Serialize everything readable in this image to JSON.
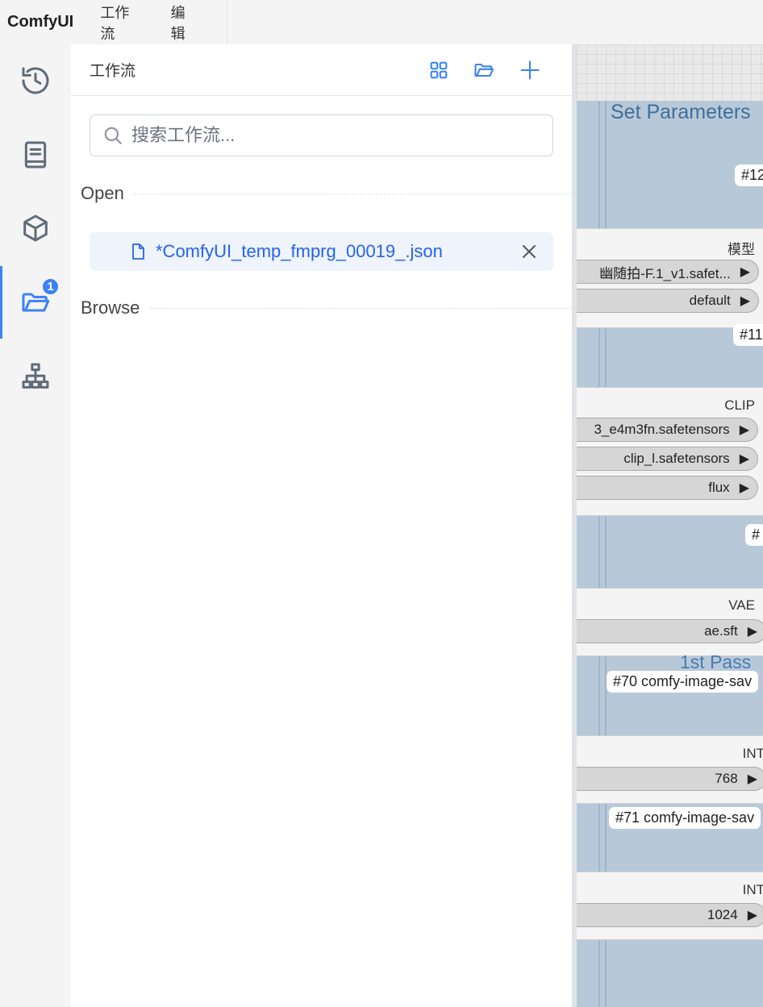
{
  "menubar": {
    "logo": "ComfyUI",
    "items": [
      "工作流",
      "编辑"
    ]
  },
  "rail": {
    "badge": "1"
  },
  "panel": {
    "title": "工作流",
    "search_placeholder": "搜索工作流...",
    "open_label": "Open",
    "browse_label": "Browse",
    "open_file": "*ComfyUI_temp_fmprg_00019_.json"
  },
  "canvas": {
    "group_title": "Set Parameters",
    "tags": [
      "#12",
      "#11",
      "#",
      "#70 comfy-image-sav",
      "#71 comfy-image-sav"
    ],
    "pass_title": "1st Pass",
    "nodes": [
      {
        "header": "模型",
        "widgets": [
          "幽随拍-F.1_v1.safet...",
          "default"
        ]
      },
      {
        "header": "CLIP",
        "widgets": [
          "3_e4m3fn.safetensors",
          "clip_l.safetensors",
          "flux"
        ]
      },
      {
        "header": "VAE",
        "widgets": [
          "ae.sft"
        ]
      },
      {
        "header": "INT",
        "widgets": [
          "768"
        ]
      },
      {
        "header": "INT",
        "widgets": [
          "1024"
        ]
      }
    ]
  },
  "colors": {
    "accent": "#3b82f6",
    "file_text": "#2563eb",
    "group": "#b7c9d9"
  }
}
